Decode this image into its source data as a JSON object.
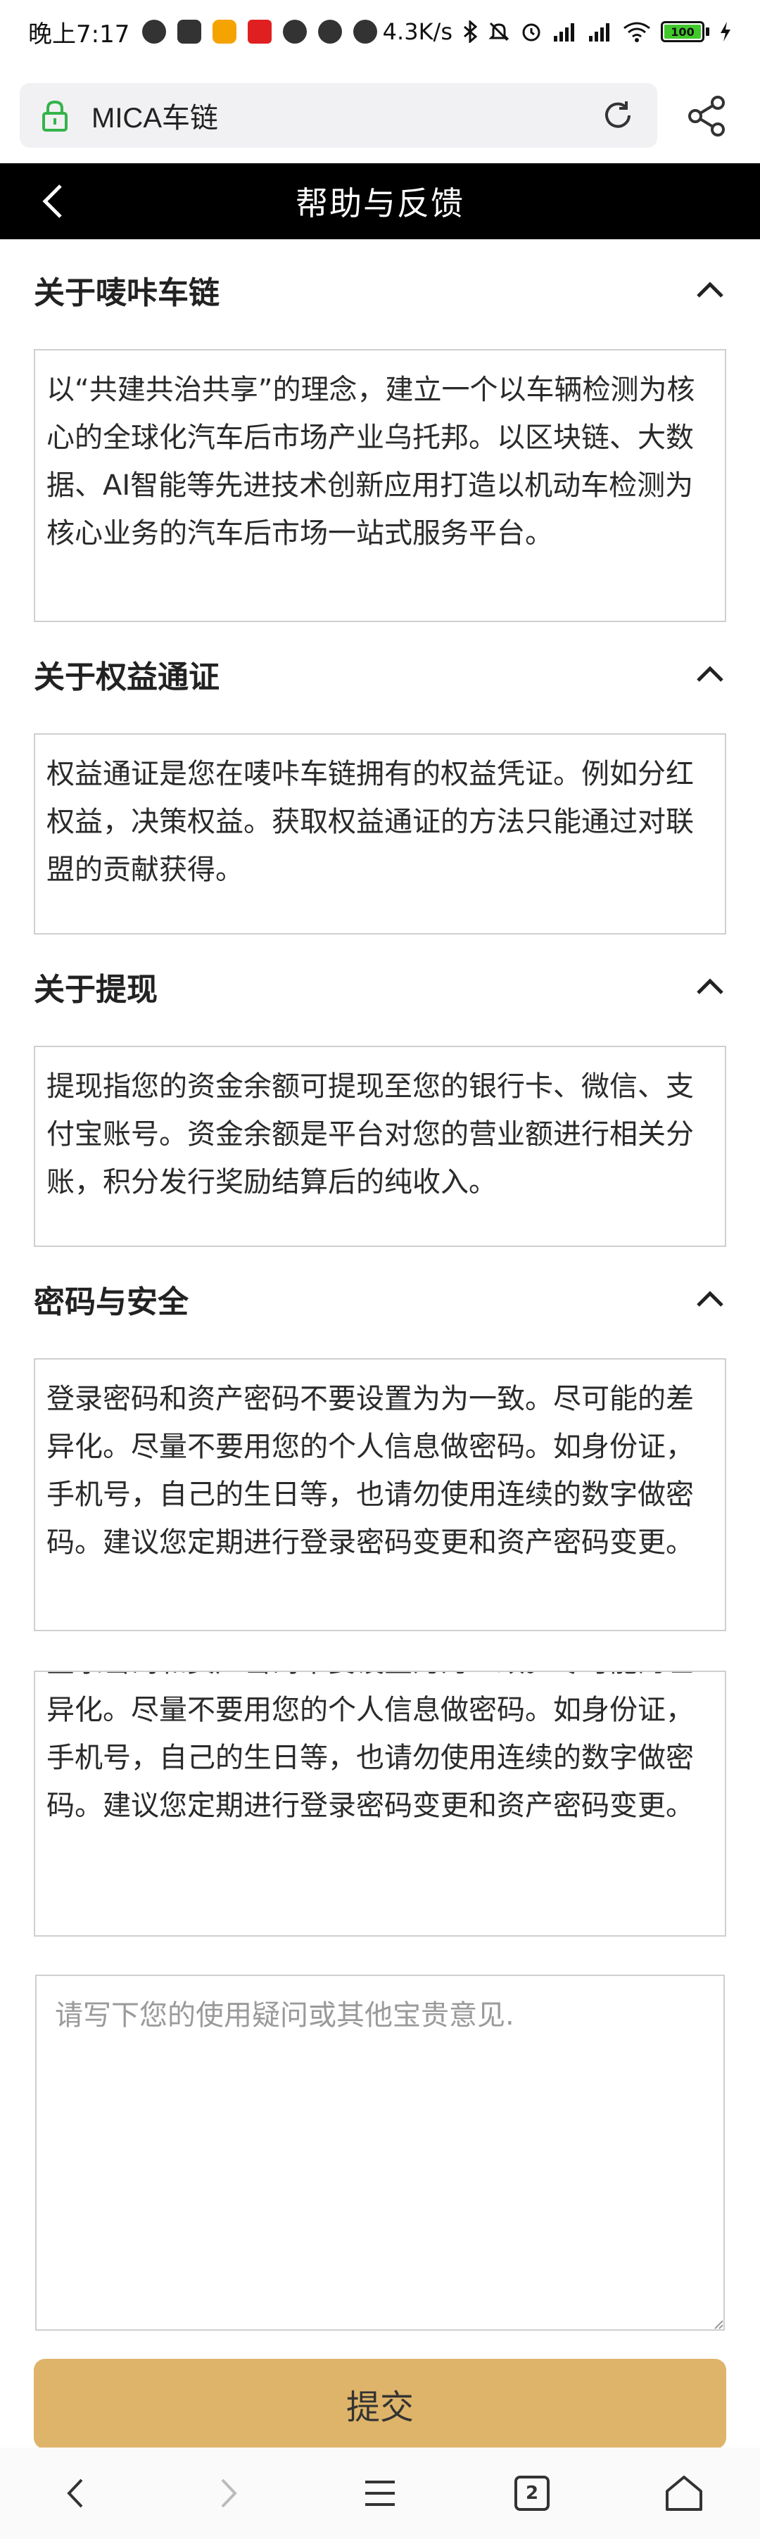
{
  "status_bar": {
    "time": "晚上7:17",
    "network_speed": "4.3K/s",
    "battery": "100"
  },
  "browser": {
    "url_text": "MICA车链"
  },
  "header": {
    "title": "帮助与反馈"
  },
  "sections": [
    {
      "title": "关于唛咔车链",
      "body": "以“共建共治共享”的理念，建立一个以车辆检测为核心的全球化汽车后市场产业乌托邦。以区块链、大数据、AI智能等先进技术创新应用打造以机动车检测为核心业务的汽车后市场一站式服务平台。"
    },
    {
      "title": "关于权益通证",
      "body": "权益通证是您在唛咔车链拥有的权益凭证。例如分红权益，决策权益。获取权益通证的方法只能通过对联盟的贡献获得。"
    },
    {
      "title": "关于提现",
      "body": "提现指您的资金余额可提现至您的银行卡、微信、支付宝账号。资金余额是平台对您的营业额进行相关分账，积分发行奖励结算后的纯收入。"
    },
    {
      "title": "密码与安全",
      "body": "登录密码和资产密码不要设置为为一致。尽可能的差异化。尽量不要用您的个人信息做密码。如身份证，手机号，自己的生日等，也请勿使用连续的数字做密码。建议您定期进行登录密码变更和资产密码变更。"
    }
  ],
  "extra_body": "登录密码和资产密码不要设置为为一致。尽可能的差异化。尽量不要用您的个人信息做密码。如身份证，手机号，自己的生日等，也请勿使用连续的数字做密码。建议您定期进行登录密码变更和资产密码变更。",
  "feedback": {
    "placeholder": "请写下您的使用疑问或其他宝贵意见."
  },
  "submit_label": "提交",
  "bottom_nav": {
    "tab_count": "2"
  },
  "colors": {
    "accent": "#deb46a",
    "header_bg": "#000000",
    "battery_fill": "#42c82c"
  }
}
